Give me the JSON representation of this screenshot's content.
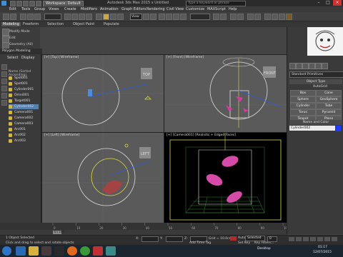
{
  "titlebar": {
    "workspace": "Workspace: Default",
    "title": "Autodesk 3ds Max 2015  x  Untitled",
    "search_placeholder": "Type a keyword or phrase"
  },
  "menubar": {
    "items": [
      "Edit",
      "Tools",
      "Group",
      "Views",
      "Create",
      "Modifiers",
      "Animation",
      "Graph Editors",
      "Rendering",
      "Civil View",
      "Customize",
      "MAXScript",
      "Help"
    ]
  },
  "toolbar": {
    "view_dropdown": "View"
  },
  "ribbon": {
    "tabs": [
      "Modeling",
      "Freeform",
      "Selection",
      "Object Paint",
      "Populate"
    ],
    "tools": [
      {
        "icon": "modify-mode-icon",
        "label": "Modify Mode"
      },
      {
        "icon": "edit-icon",
        "label": "Edit"
      },
      {
        "icon": "geometry-icon",
        "label": "Geometry (All)"
      }
    ],
    "panel_label": "Polygon Modeling"
  },
  "scene_explorer": {
    "tabs": [
      "Select",
      "Display"
    ],
    "header": "Name (Sorted Ascending)",
    "items": [
      {
        "name": "Spot001",
        "selected": false
      },
      {
        "name": "Spot001",
        "selected": false
      },
      {
        "name": "Cylinder001",
        "selected": false
      },
      {
        "name": "Omni001",
        "selected": false
      },
      {
        "name": "Target001",
        "selected": false
      },
      {
        "name": "Cylinder002",
        "selected": true
      },
      {
        "name": "Camera001",
        "selected": false
      },
      {
        "name": "Camera002",
        "selected": false
      },
      {
        "name": "Camera003",
        "selected": false
      },
      {
        "name": "Arc001",
        "selected": false
      },
      {
        "name": "Arc002",
        "selected": false
      },
      {
        "name": "Arc003",
        "selected": false
      }
    ]
  },
  "viewports": {
    "top": {
      "label": "[+] [Top] [Wireframe]",
      "cube": "TOP"
    },
    "front": {
      "label": "[+] [Front] [Wireframe]",
      "cube": "FRONT"
    },
    "left": {
      "label": "[+] [Left] [Wireframe]",
      "cube": "LEFT"
    },
    "camera": {
      "label": "[+] [Camera001] [Realistic + Edged Faces]"
    }
  },
  "command_panel": {
    "category": "Standard Primitives",
    "object_type_title": "Object Type",
    "autogrid": "AutoGrid",
    "buttons": [
      "Box",
      "Cone",
      "Sphere",
      "GeoSphere",
      "Cylinder",
      "Tube",
      "Torus",
      "Pyramid",
      "Teapot",
      "Plane"
    ],
    "name_color_title": "Name and Color",
    "object_name": "Cylinder002",
    "color": "#1e3cff"
  },
  "timeline": {
    "frame": "0 / 100",
    "ruler_ticks": [
      "0",
      "10",
      "20",
      "30",
      "40",
      "50",
      "60",
      "70",
      "80",
      "90",
      "100"
    ]
  },
  "status": {
    "selection": "1 Object Selected",
    "hint": "Click and drag to select and rotate objects",
    "x": "X:",
    "y": "Y:",
    "z": "Z:",
    "grid": "Grid = 10.0cm",
    "autokey": "Auto Key",
    "selected": "Selected",
    "setkey": "Set Key",
    "filters": "Key Filters...",
    "frame_field": "0",
    "add_time_tag": "Add Time Tag"
  },
  "taskbar": {
    "desktop": "Desktop",
    "time": "01:17",
    "date": "12/07/2015"
  }
}
